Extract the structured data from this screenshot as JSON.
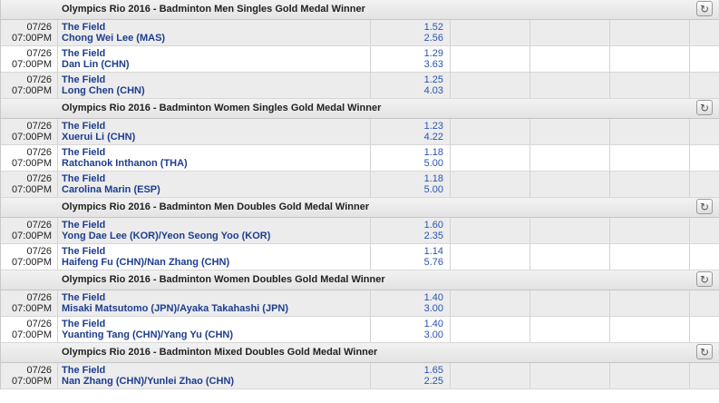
{
  "refresh_icon": "↻",
  "sections": [
    {
      "title": "Olympics Rio 2016 - Badminton Men Singles Gold Medal Winner",
      "rows": [
        {
          "date": "07/26",
          "time": "07:00PM",
          "line1": "The Field",
          "line2": "Chong Wei Lee (MAS)",
          "odds1": "1.52",
          "odds2": "2.56"
        },
        {
          "date": "07/26",
          "time": "07:00PM",
          "line1": "The Field",
          "line2": "Dan Lin (CHN)",
          "odds1": "1.29",
          "odds2": "3.63"
        },
        {
          "date": "07/26",
          "time": "07:00PM",
          "line1": "The Field",
          "line2": "Long Chen (CHN)",
          "odds1": "1.25",
          "odds2": "4.03"
        }
      ]
    },
    {
      "title": "Olympics Rio 2016 - Badminton Women Singles Gold Medal Winner",
      "rows": [
        {
          "date": "07/26",
          "time": "07:00PM",
          "line1": "The Field",
          "line2": "Xuerui Li (CHN)",
          "odds1": "1.23",
          "odds2": "4.22"
        },
        {
          "date": "07/26",
          "time": "07:00PM",
          "line1": "The Field",
          "line2": "Ratchanok Inthanon (THA)",
          "odds1": "1.18",
          "odds2": "5.00"
        },
        {
          "date": "07/26",
          "time": "07:00PM",
          "line1": "The Field",
          "line2": "Carolina Marin (ESP)",
          "odds1": "1.18",
          "odds2": "5.00"
        }
      ]
    },
    {
      "title": "Olympics Rio 2016 - Badminton Men Doubles Gold Medal Winner",
      "rows": [
        {
          "date": "07/26",
          "time": "07:00PM",
          "line1": "The Field",
          "line2": "Yong Dae Lee (KOR)/Yeon Seong Yoo (KOR)",
          "odds1": "1.60",
          "odds2": "2.35"
        },
        {
          "date": "07/26",
          "time": "07:00PM",
          "line1": "The Field",
          "line2": "Haifeng Fu (CHN)/Nan Zhang (CHN)",
          "odds1": "1.14",
          "odds2": "5.76"
        }
      ]
    },
    {
      "title": "Olympics Rio 2016 - Badminton Women Doubles Gold Medal Winner",
      "rows": [
        {
          "date": "07/26",
          "time": "07:00PM",
          "line1": "The Field",
          "line2": "Misaki Matsutomo (JPN)/Ayaka Takahashi (JPN)",
          "odds1": "1.40",
          "odds2": "3.00"
        },
        {
          "date": "07/26",
          "time": "07:00PM",
          "line1": "The Field",
          "line2": "Yuanting Tang (CHN)/Yang Yu (CHN)",
          "odds1": "1.40",
          "odds2": "3.00"
        }
      ]
    },
    {
      "title": "Olympics Rio 2016 - Badminton Mixed Doubles Gold Medal Winner",
      "rows": [
        {
          "date": "07/26",
          "time": "07:00PM",
          "line1": "The Field",
          "line2": "Nan Zhang (CHN)/Yunlei Zhao (CHN)",
          "odds1": "1.65",
          "odds2": "2.25"
        }
      ]
    }
  ]
}
